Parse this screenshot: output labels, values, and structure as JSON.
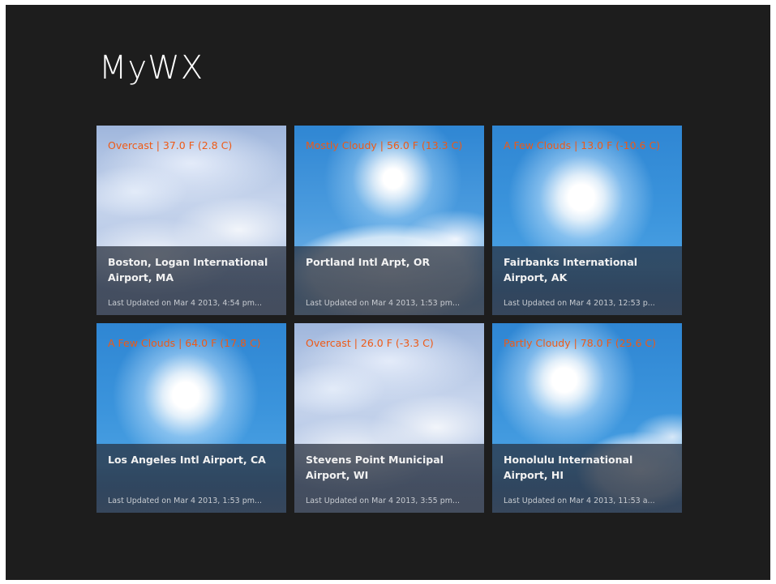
{
  "app": {
    "title": "MyWX",
    "colors": {
      "background": "#1d1d1d",
      "condition_text": "#ee5a16",
      "overlay": "#2c3442"
    }
  },
  "tiles": [
    {
      "condition": "Overcast | 37.0 F (2.8 C)",
      "location": "Boston, Logan International Airport, MA",
      "updated": "Last Updated on Mar 4 2013, 4:54 pm...",
      "image": "overcast-clouds-image"
    },
    {
      "condition": "Mostly Cloudy | 56.0 F (13.3 C)",
      "location": "Portland Intl Arpt, OR",
      "updated": "Last Updated on Mar 4 2013, 1:53 pm...",
      "image": "mostly-cloudy-image"
    },
    {
      "condition": "A Few Clouds | 13.0 F (-10.6 C)",
      "location": "Fairbanks International Airport, AK",
      "updated": "Last Updated on Mar 4 2013, 12:53 p...",
      "image": "sunny-image"
    },
    {
      "condition": "A Few Clouds | 64.0 F (17.8 C)",
      "location": "Los Angeles Intl Airport, CA",
      "updated": "Last Updated on Mar 4 2013, 1:53 pm...",
      "image": "sunny-image"
    },
    {
      "condition": "Overcast | 26.0 F (-3.3 C)",
      "location": "Stevens Point Municipal Airport, WI",
      "updated": "Last Updated on Mar 4 2013, 3:55 pm...",
      "image": "overcast-clouds-image"
    },
    {
      "condition": "Partly Cloudy | 78.0 F (25.6 C)",
      "location": "Honolulu International Airport, HI",
      "updated": "Last Updated on Mar 4 2013, 11:53 a...",
      "image": "partly-cloudy-image"
    }
  ]
}
